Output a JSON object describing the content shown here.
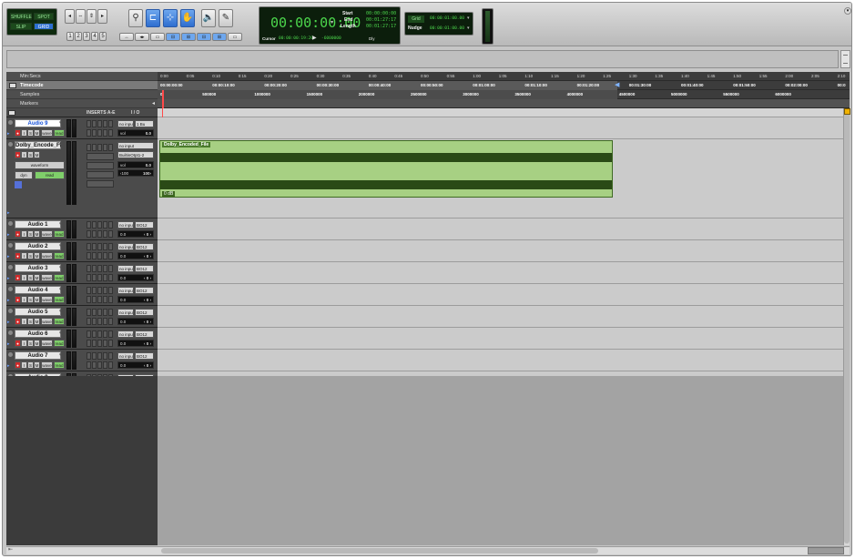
{
  "toolbar": {
    "mode_buttons": [
      "SHUFFLE",
      "SPOT",
      "SLIP",
      "GRID"
    ],
    "zoom_presets": [
      "1",
      "2",
      "3",
      "4",
      "5"
    ],
    "counter": {
      "main": "00:00:00:00",
      "start_label": "Start",
      "end_label": "End",
      "length_label": "Length",
      "start": "00:00:00:00",
      "end": "00:01:27:17",
      "length": "00:01:27:17",
      "cursor_label": "Cursor",
      "cursor": "00:00:00:19:20",
      "cursor_samples": "-6000000",
      "dly_label": "Dly"
    },
    "grid": {
      "grid_label": "Grid",
      "grid_value": "00:00:01:00.00",
      "nudge_label": "Nudge",
      "nudge_value": "00:00:01:00.00"
    }
  },
  "rulers": {
    "labels": [
      "Min:Secs",
      "Timecode",
      "Samples",
      "Markers"
    ],
    "minsecs": [
      "0:00",
      "0:05",
      "0:10",
      "0:15",
      "0:20",
      "0:25",
      "0:30",
      "0:35",
      "0:40",
      "0:45",
      "0:50",
      "0:55",
      "1:00",
      "1:05",
      "1:10",
      "1:15",
      "1:20",
      "1:25",
      "1:30",
      "1:35",
      "1:40",
      "1:45",
      "1:50",
      "1:55",
      "2:00",
      "2:05",
      "2:10"
    ],
    "timecode": [
      "00:00:00:00",
      "00:00:10:00",
      "00:00:20:00",
      "00:00:30:00",
      "00:00:40:00",
      "00:00:50:00",
      "00:01:00:00",
      "00:01:10:00",
      "00:01:20:00",
      "00:01:30:00",
      "00:01:40:00",
      "00:01:50:00",
      "00:02:00:00",
      "00:0"
    ],
    "samples": [
      "0",
      "500000",
      "1000000",
      "1500000",
      "2000000",
      "2500000",
      "3000000",
      "3500000",
      "4000000",
      "4500000",
      "5000000",
      "5500000",
      "6000000"
    ]
  },
  "column_headers": {
    "inserts": "INSERTS A-E",
    "io": "I / O"
  },
  "tracks": [
    {
      "name": "Audio 9",
      "io": "no input",
      "out": "1 Bu",
      "vol": "vol",
      "vol_val": "0.0",
      "selected": true
    },
    {
      "name": "Dolby_Encode_Fl",
      "io": "no input",
      "out": "BuiltinOtpt1-2",
      "vol": "vol",
      "vol_val": "0.0",
      "pan_l": "‹100",
      "pan_r": "100›",
      "view": "waveform",
      "auto": "dyn",
      "auto2": "read"
    },
    {
      "name": "Audio 1",
      "io": "no input",
      "out": "BO12",
      "vol": "0.0",
      "pan": "‹ 0 ›"
    },
    {
      "name": "Audio 2",
      "io": "no input",
      "out": "BO12",
      "vol": "0.0",
      "pan": "‹ 0 ›"
    },
    {
      "name": "Audio 3",
      "io": "no input",
      "out": "BO12",
      "vol": "0.0",
      "pan": "‹ 0 ›"
    },
    {
      "name": "Audio 4",
      "io": "no input",
      "out": "BO12",
      "vol": "0.0",
      "pan": "‹ 0 ›"
    },
    {
      "name": "Audio 5",
      "io": "no input",
      "out": "BO12",
      "vol": "0.0",
      "pan": "‹ 0 ›"
    },
    {
      "name": "Audio 6",
      "io": "no input",
      "out": "BO12",
      "vol": "0.0",
      "pan": "‹ 0 ›"
    },
    {
      "name": "Audio 7",
      "io": "no input",
      "out": "BO12",
      "vol": "0.0",
      "pan": "‹ 0 ›"
    },
    {
      "name": "Audio 8",
      "io": "no input",
      "out": "BO12",
      "vol": "0.0",
      "pan": "‹ 0 ›"
    }
  ],
  "rsm": {
    "r": "●",
    "i": "I",
    "s": "S",
    "m": "M",
    "wave": "wave",
    "read": "read"
  },
  "clip": {
    "name": "Dolby_Encoded_File",
    "gain": "0 dB"
  },
  "colors": {
    "lcd_green": "#4cd64c",
    "clip_green": "#a7d083",
    "selected_blue": "#1550d8",
    "record_red": "#cf2a2a"
  }
}
